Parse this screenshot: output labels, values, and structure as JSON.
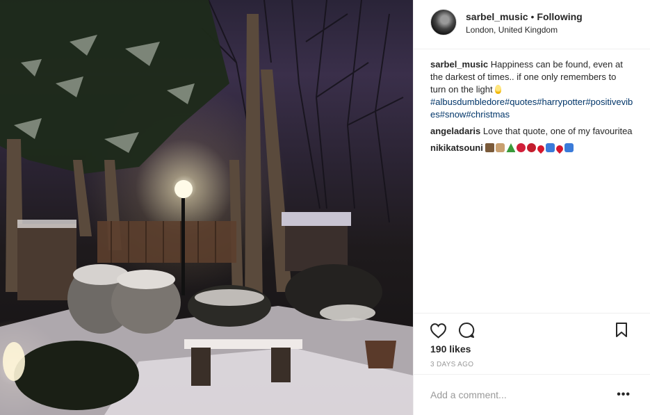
{
  "post": {
    "author": {
      "username": "sarbel_music",
      "separator": "•",
      "follow_status": "Following",
      "location": "London, United Kingdom"
    },
    "caption": {
      "username": "sarbel_music",
      "text": "Happiness can be found, even at the darkest of times.. if one only remembers to turn on the light",
      "emoji": "light-bulb",
      "hashtags": [
        "#albusdumbledore",
        "#quotes",
        "#harrypotter",
        "#positivevibes",
        "#snow",
        "#christmas"
      ]
    },
    "comments": [
      {
        "username": "angeladaris",
        "text": "Love that quote, one of my favouritea"
      },
      {
        "username": "nikikatsouni",
        "text": "",
        "emojis": [
          "heart-icon-1",
          "house-icon",
          "christmas-tree-icon",
          "lips-icon",
          "lips-icon",
          "heart-icon",
          "top-icon",
          "heart-icon",
          "top-icon"
        ]
      }
    ],
    "likes": "190 likes",
    "timestamp": "3 DAYS AGO",
    "add_comment_placeholder": "Add a comment...",
    "more_options": "•••"
  },
  "icons": {
    "like": "heart-outline-icon",
    "comment": "speech-bubble-icon",
    "save": "bookmark-icon"
  },
  "colors": {
    "text": "#262626",
    "hashtag": "#003569",
    "muted": "#999999",
    "border": "#efefef"
  }
}
